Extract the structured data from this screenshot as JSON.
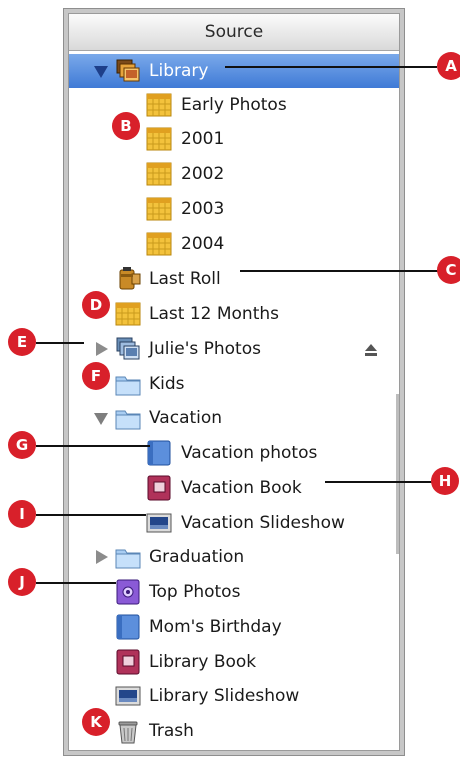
{
  "header": {
    "title": "Source"
  },
  "rows": {
    "library": {
      "label": "Library"
    },
    "early_photos": {
      "label": "Early Photos"
    },
    "y2001": {
      "label": "2001"
    },
    "y2002": {
      "label": "2002"
    },
    "y2003": {
      "label": "2003"
    },
    "y2004": {
      "label": "2004"
    },
    "last_roll": {
      "label": "Last Roll"
    },
    "last_12_months": {
      "label": "Last 12 Months"
    },
    "julies_photos": {
      "label": "Julie's Photos"
    },
    "kids": {
      "label": "Kids"
    },
    "vacation": {
      "label": "Vacation"
    },
    "vacation_photos": {
      "label": "Vacation photos"
    },
    "vacation_book": {
      "label": "Vacation Book"
    },
    "vacation_slideshow": {
      "label": "Vacation Slideshow"
    },
    "graduation": {
      "label": "Graduation"
    },
    "top_photos": {
      "label": "Top Photos"
    },
    "moms_birthday": {
      "label": "Mom's Birthday"
    },
    "library_book": {
      "label": "Library Book"
    },
    "library_slideshow": {
      "label": "Library Slideshow"
    },
    "trash": {
      "label": "Trash"
    }
  },
  "callouts": {
    "a": "A",
    "b": "B",
    "c": "C",
    "d": "D",
    "e": "E",
    "f": "F",
    "g": "G",
    "h": "H",
    "i": "I",
    "j": "J",
    "k": "K"
  },
  "colors": {
    "selection": "#3f7ad6",
    "callout": "#d8202a"
  }
}
